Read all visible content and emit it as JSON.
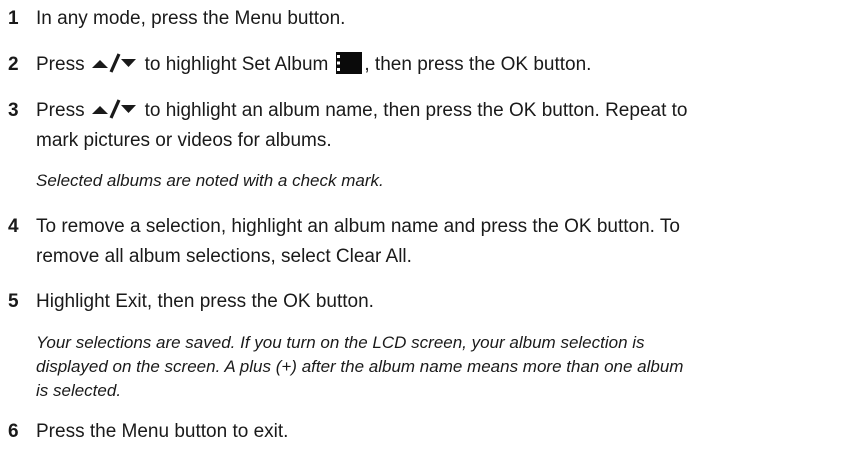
{
  "steps": [
    {
      "number": "1",
      "text": "In any mode, press the Menu button."
    },
    {
      "number": "2",
      "before": "Press",
      "mid": "to highlight Set Album",
      "after": ", then press the OK button."
    },
    {
      "number": "3",
      "before": "Press",
      "line1_after": "to highlight an album name, then press the OK button. Repeat to",
      "line2": "mark pictures or videos for albums.",
      "note": "Selected albums are noted with a check mark."
    },
    {
      "number": "4",
      "line1": "To remove a selection, highlight an album name and press the OK button. To",
      "line2": "remove all album selections, select Clear All."
    },
    {
      "number": "5",
      "text": "Highlight Exit, then press the OK button.",
      "note_lines": [
        "Your selections are saved. If you turn on the LCD screen, your album selection is",
        "displayed on the screen. A plus (+) after the album name means more than one album",
        "is selected."
      ]
    },
    {
      "number": "6",
      "text": "Press the Menu button to exit."
    }
  ],
  "icons": {
    "arrows": "up-down-arrows-icon",
    "album": "set-album-icon"
  }
}
